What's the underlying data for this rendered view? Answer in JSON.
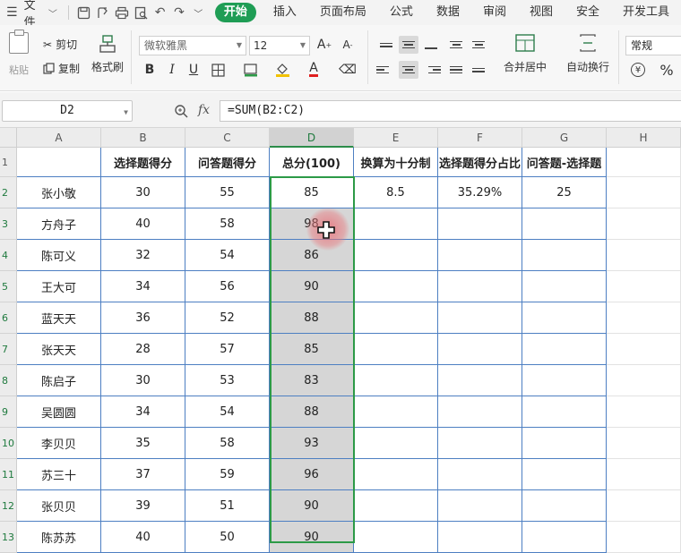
{
  "menu": {
    "file_label": "文件",
    "tabs": [
      "开始",
      "插入",
      "页面布局",
      "公式",
      "数据",
      "审阅",
      "视图",
      "安全",
      "开发工具"
    ]
  },
  "ribbon": {
    "paste_label": "粘贴",
    "cut_label": "剪切",
    "copy_label": "复制",
    "format_painter_label": "格式刷",
    "font_name": "微软雅黑",
    "font_size": "12",
    "merge_label": "合并居中",
    "wrap_label": "自动换行",
    "number_format": "常规",
    "currency_symbol": "¥",
    "percent_symbol": "%"
  },
  "formula_bar": {
    "name_box": "D2",
    "fx_label": "fx",
    "formula": "=SUM(B2:C2)"
  },
  "sheet": {
    "columns": [
      "A",
      "B",
      "C",
      "D",
      "E",
      "F",
      "G",
      "H"
    ],
    "selected_column": "D",
    "headers": [
      "",
      "选择题得分",
      "问答题得分",
      "总分(100)",
      "换算为十分制",
      "选择题得分占比",
      "问答题-选择题"
    ],
    "rows": [
      {
        "num": "2",
        "name": "张小敬",
        "b": "30",
        "c": "55",
        "d": "85",
        "e": "8.5",
        "f": "35.29%",
        "g": "25"
      },
      {
        "num": "3",
        "name": "方舟子",
        "b": "40",
        "c": "58",
        "d": "98",
        "e": "",
        "f": "",
        "g": ""
      },
      {
        "num": "4",
        "name": "陈可义",
        "b": "32",
        "c": "54",
        "d": "86",
        "e": "",
        "f": "",
        "g": ""
      },
      {
        "num": "5",
        "name": "王大可",
        "b": "34",
        "c": "56",
        "d": "90",
        "e": "",
        "f": "",
        "g": ""
      },
      {
        "num": "6",
        "name": "蓝天天",
        "b": "36",
        "c": "52",
        "d": "88",
        "e": "",
        "f": "",
        "g": ""
      },
      {
        "num": "7",
        "name": "张天天",
        "b": "28",
        "c": "57",
        "d": "85",
        "e": "",
        "f": "",
        "g": ""
      },
      {
        "num": "8",
        "name": "陈启子",
        "b": "30",
        "c": "53",
        "d": "83",
        "e": "",
        "f": "",
        "g": ""
      },
      {
        "num": "9",
        "name": "吴圆圆",
        "b": "34",
        "c": "54",
        "d": "88",
        "e": "",
        "f": "",
        "g": ""
      },
      {
        "num": "10",
        "name": "李贝贝",
        "b": "35",
        "c": "58",
        "d": "93",
        "e": "",
        "f": "",
        "g": ""
      },
      {
        "num": "11",
        "name": "苏三十",
        "b": "37",
        "c": "59",
        "d": "96",
        "e": "",
        "f": "",
        "g": ""
      },
      {
        "num": "12",
        "name": "张贝贝",
        "b": "39",
        "c": "51",
        "d": "90",
        "e": "",
        "f": "",
        "g": ""
      },
      {
        "num": "13",
        "name": "陈苏苏",
        "b": "40",
        "c": "50",
        "d": "90",
        "e": "",
        "f": "",
        "g": ""
      }
    ]
  },
  "colors": {
    "accent_green": "#1f9d55",
    "selection_green": "#2c9a47",
    "grid_blue": "#4d7fc2"
  }
}
